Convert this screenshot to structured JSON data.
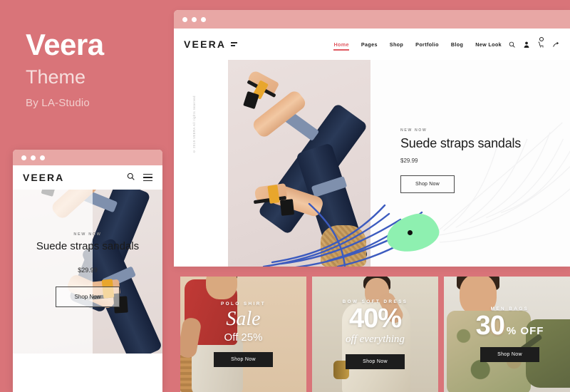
{
  "branding": {
    "title": "Veera",
    "subtitle": "Theme",
    "author": "By LA-Studio"
  },
  "colors": {
    "background": "#d97479",
    "browser_bar": "#e8a7a5",
    "accent": "#e05a62",
    "blob_green": "#8ef0b0",
    "swoosh_blue": "#3c5bbf",
    "sandal_yellow": "#e8a62c"
  },
  "desktop": {
    "browser_dots": [
      "dot",
      "dot",
      "dot"
    ],
    "logo": "VEERA",
    "nav": [
      {
        "label": "Home",
        "active": true
      },
      {
        "label": "Pages",
        "active": false
      },
      {
        "label": "Shop",
        "active": false
      },
      {
        "label": "Portfolio",
        "active": false
      },
      {
        "label": "Blog",
        "active": false
      },
      {
        "label": "New Look",
        "active": false
      }
    ],
    "icons": [
      "search-icon",
      "user-icon",
      "cart-icon",
      "share-icon"
    ],
    "vertical_note": "© 2019 VEERA All rights reserved",
    "hero": {
      "eyebrow": "NEW NOW",
      "title": "Suede straps sandals",
      "price": "$29.99",
      "button": "Shop Now"
    }
  },
  "promos": [
    {
      "eyebrow": "POLO SHIRT",
      "script": "Sale",
      "sub": "Off 25%",
      "button": "Shop Now"
    },
    {
      "eyebrow": "BOW SOFT DRESS",
      "big": "40%",
      "italic": "off everything",
      "button": "Shop Now"
    },
    {
      "eyebrow": "MEN BAGS",
      "big": "30",
      "off": "% OFF",
      "button": "Shop Now"
    }
  ],
  "mobile": {
    "browser_dots": [
      "dot",
      "dot",
      "dot"
    ],
    "logo": "VEERA",
    "icons": [
      "search-icon",
      "menu-icon"
    ],
    "hero": {
      "eyebrow": "NEW NOW",
      "title": "Suede straps sandals",
      "price": "$29.99",
      "button": "Shop Now"
    }
  }
}
